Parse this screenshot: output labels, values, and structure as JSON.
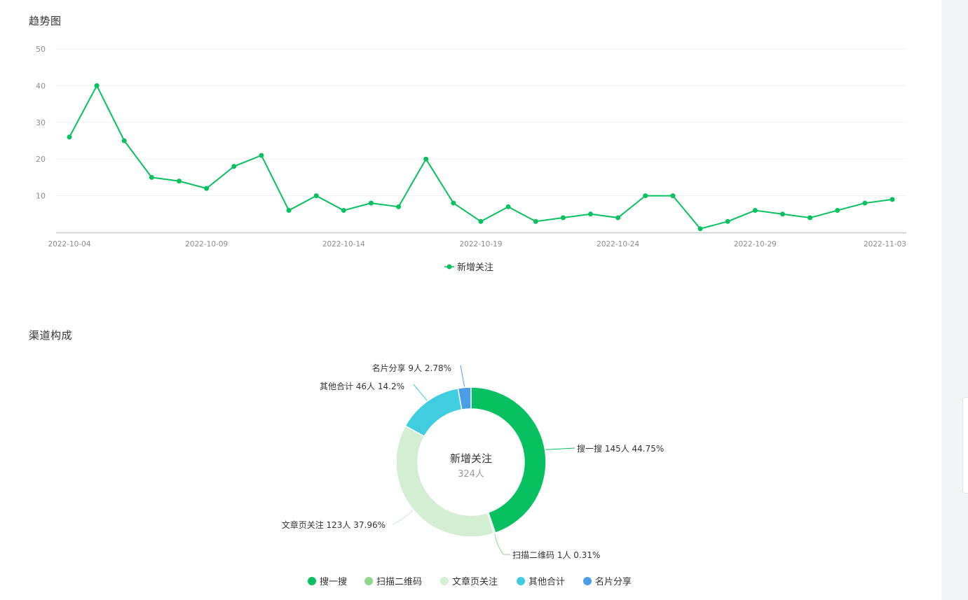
{
  "trend": {
    "title": "趋势图",
    "legend_label": "新增关注",
    "color": "#07c160"
  },
  "channel": {
    "title": "渠道构成",
    "center_title": "新增关注",
    "center_value": "324人"
  },
  "chart_data": [
    {
      "type": "line",
      "title": "趋势图",
      "series": [
        {
          "name": "新增关注",
          "color": "#07c160",
          "values": [
            26,
            40,
            25,
            15,
            14,
            12,
            18,
            21,
            6,
            10,
            6,
            8,
            7,
            20,
            8,
            3,
            7,
            3,
            4,
            5,
            4,
            10,
            10,
            1,
            3,
            6,
            5,
            4,
            6,
            8,
            9
          ]
        }
      ],
      "x": [
        "2022-10-04",
        "2022-10-05",
        "2022-10-06",
        "2022-10-07",
        "2022-10-08",
        "2022-10-09",
        "2022-10-10",
        "2022-10-11",
        "2022-10-12",
        "2022-10-13",
        "2022-10-14",
        "2022-10-15",
        "2022-10-16",
        "2022-10-17",
        "2022-10-18",
        "2022-10-19",
        "2022-10-20",
        "2022-10-21",
        "2022-10-22",
        "2022-10-23",
        "2022-10-24",
        "2022-10-25",
        "2022-10-26",
        "2022-10-27",
        "2022-10-28",
        "2022-10-29",
        "2022-10-30",
        "2022-10-31",
        "2022-11-01",
        "2022-11-02",
        "2022-11-03"
      ],
      "x_tick_labels": [
        "2022-10-04",
        "2022-10-09",
        "2022-10-14",
        "2022-10-19",
        "2022-10-24",
        "2022-10-29",
        "2022-11-03"
      ],
      "y_ticks": [
        "10",
        "20",
        "30",
        "40",
        "50"
      ],
      "ylim": [
        0,
        50
      ],
      "grid": true,
      "legend": "bottom-center"
    },
    {
      "type": "pie",
      "title": "渠道构成",
      "slices": [
        {
          "name": "搜一搜",
          "value": 145,
          "count_label": "145人",
          "percent": "44.75%",
          "color": "#07c160"
        },
        {
          "name": "扫描二维码",
          "value": 1,
          "count_label": "1人",
          "percent": "0.31%",
          "color": "#8fd78a"
        },
        {
          "name": "文章页关注",
          "value": 123,
          "count_label": "123人",
          "percent": "37.96%",
          "color": "#d2efd2"
        },
        {
          "name": "其他合计",
          "value": 46,
          "count_label": "46人",
          "percent": "14.2%",
          "color": "#40cde0"
        },
        {
          "name": "名片分享",
          "value": 9,
          "count_label": "9人",
          "percent": "2.78%",
          "color": "#4a9ee8"
        }
      ],
      "legend": "bottom-center"
    }
  ]
}
